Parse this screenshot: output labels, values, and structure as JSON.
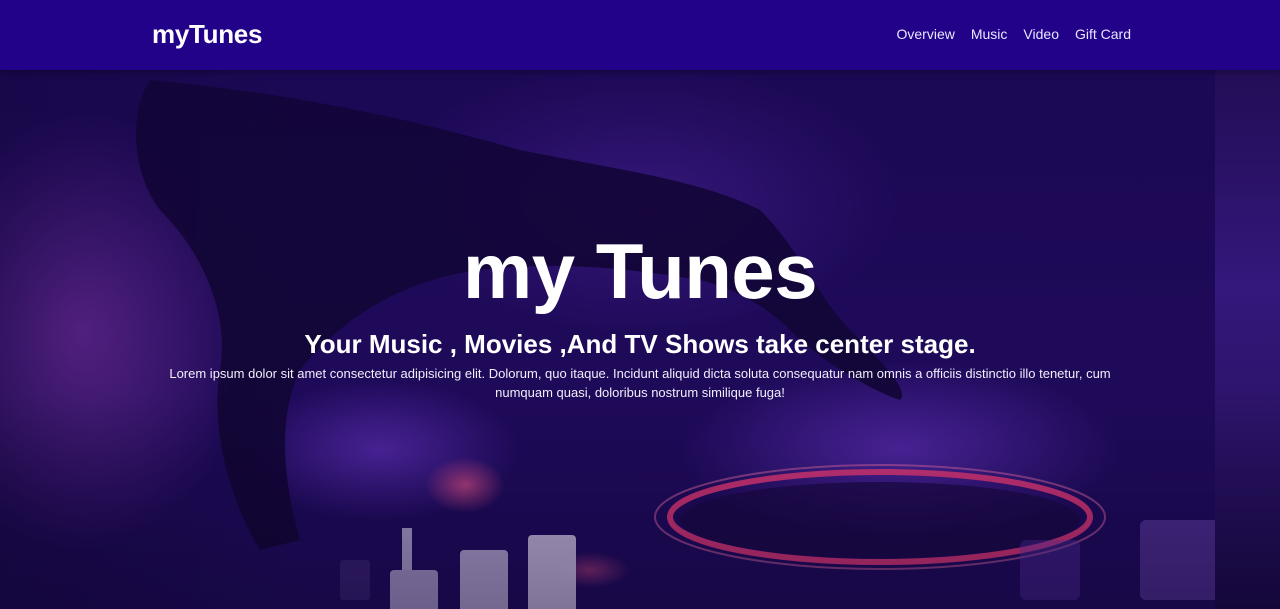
{
  "navbar": {
    "brand": "myTunes",
    "links": [
      {
        "label": "Overview"
      },
      {
        "label": "Music"
      },
      {
        "label": "Video"
      },
      {
        "label": "Gift Card"
      }
    ]
  },
  "hero": {
    "title": "my Tunes",
    "subtitle": "Your Music , Movies ,And TV Shows take center stage.",
    "text": "Lorem ipsum dolor sit amet consectetur adipisicing elit. Dolorum, quo itaque. Incidunt aliquid dicta soluta consequatur nam omnis a officiis distinctio illo tenetur, cum numquam quasi, doloribus nostrum similique fuga!"
  },
  "colors": {
    "navbar_bg": "#23028a",
    "text": "#ffffff"
  }
}
